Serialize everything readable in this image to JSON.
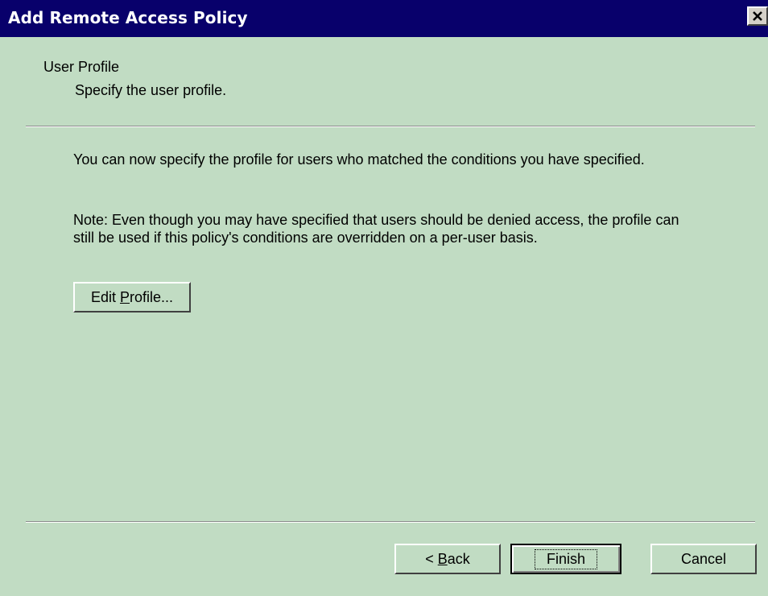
{
  "window": {
    "title": "Add Remote Access Policy"
  },
  "header": {
    "title": "User Profile",
    "subtitle": "Specify the user profile."
  },
  "content": {
    "paragraph1": "You can now specify the profile for users who matched the conditions you have specified.",
    "paragraph2": "Note: Even though you may have specified that users should be denied access, the profile can still be used if this policy's conditions are overridden on a per-user basis."
  },
  "buttons": {
    "edit_profile": {
      "before": "Edit ",
      "mnemonic": "P",
      "after": "rofile..."
    },
    "back": {
      "before": "< ",
      "mnemonic": "B",
      "after": "ack"
    },
    "finish": "Finish",
    "cancel": "Cancel"
  },
  "colors": {
    "titlebar": "#08006b",
    "dialog_background": "#c1dcc3"
  }
}
